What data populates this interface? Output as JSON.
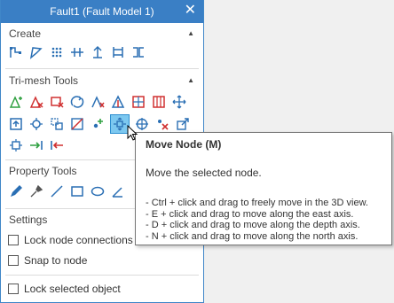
{
  "window": {
    "title": "Fault1 (Fault Model 1)",
    "close_glyph": "✕"
  },
  "sections": {
    "create": {
      "label": "Create",
      "collapse_glyph": "▲"
    },
    "trimesh": {
      "label": "Tri-mesh Tools",
      "collapse_glyph": "▲"
    },
    "property": {
      "label": "Property Tools"
    },
    "settings": {
      "label": "Settings"
    }
  },
  "settings": {
    "lock_node_connections": "Lock node connections",
    "snap_to_node": "Snap to node",
    "lock_selected_object": "Lock selected object"
  },
  "tooltip": {
    "title": "Move Node (M)",
    "description": "Move the selected node.",
    "lines": [
      "- Ctrl + click and drag to freely move in the 3D view.",
      "- E + click and drag to move along the east axis.",
      "- D + click and drag to move along the depth axis.",
      "- N + click and drag to move along the north axis."
    ]
  },
  "colors": {
    "title_bar": "#3a7fc5",
    "icon_blue": "#2a6fb4",
    "icon_red": "#d03030",
    "icon_green": "#2fa040",
    "selected": "#7cc8f0"
  }
}
